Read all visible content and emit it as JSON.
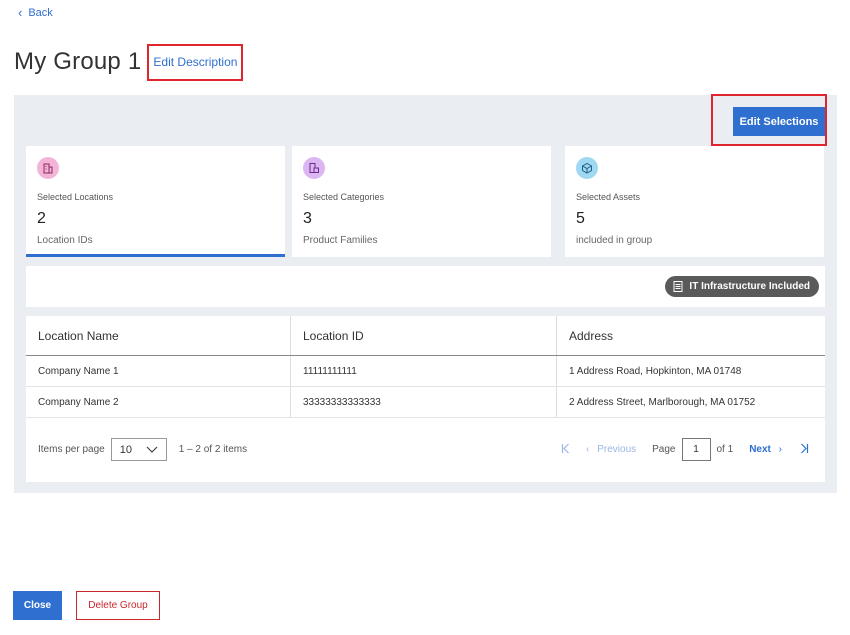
{
  "nav": {
    "back_label": "Back"
  },
  "header": {
    "title": "My Group 1",
    "edit_description_label": "Edit Description"
  },
  "toolbar": {
    "edit_selections_label": "Edit Selections"
  },
  "cards": [
    {
      "label": "Selected Locations",
      "count": "2",
      "sub": "Location IDs",
      "icon": "building-icon",
      "color": "#f3b4d8"
    },
    {
      "label": "Selected Categories",
      "count": "3",
      "sub": "Product Families",
      "icon": "categories-icon",
      "color": "#dcb6f2"
    },
    {
      "label": "Selected Assets",
      "count": "5",
      "sub": "included in group",
      "icon": "cube-icon",
      "color": "#9fd8f2"
    }
  ],
  "badge": {
    "label": "IT Infrastructure Included",
    "icon": "server-icon"
  },
  "table": {
    "headers": [
      "Location Name",
      "Location ID",
      "Address"
    ],
    "rows": [
      [
        "Company Name 1",
        "11111111111",
        "1 Address Road, Hopkinton, MA 01748"
      ],
      [
        "Company Name 2",
        "33333333333333",
        "2 Address Street, Marlborough, MA 01752"
      ]
    ]
  },
  "pager": {
    "items_per_page_label": "Items per page",
    "items_per_page_value": "10",
    "range_label": "1 – 2 of 2 items",
    "previous_label": "Previous",
    "page_label": "Page",
    "page_value": "1",
    "of_label": "of 1",
    "next_label": "Next"
  },
  "footer": {
    "close_label": "Close",
    "delete_label": "Delete Group"
  },
  "colors": {
    "accent": "#2f6fd0",
    "danger": "#c9272d",
    "highlight": "#e0262c",
    "panel": "#eaeef3"
  }
}
